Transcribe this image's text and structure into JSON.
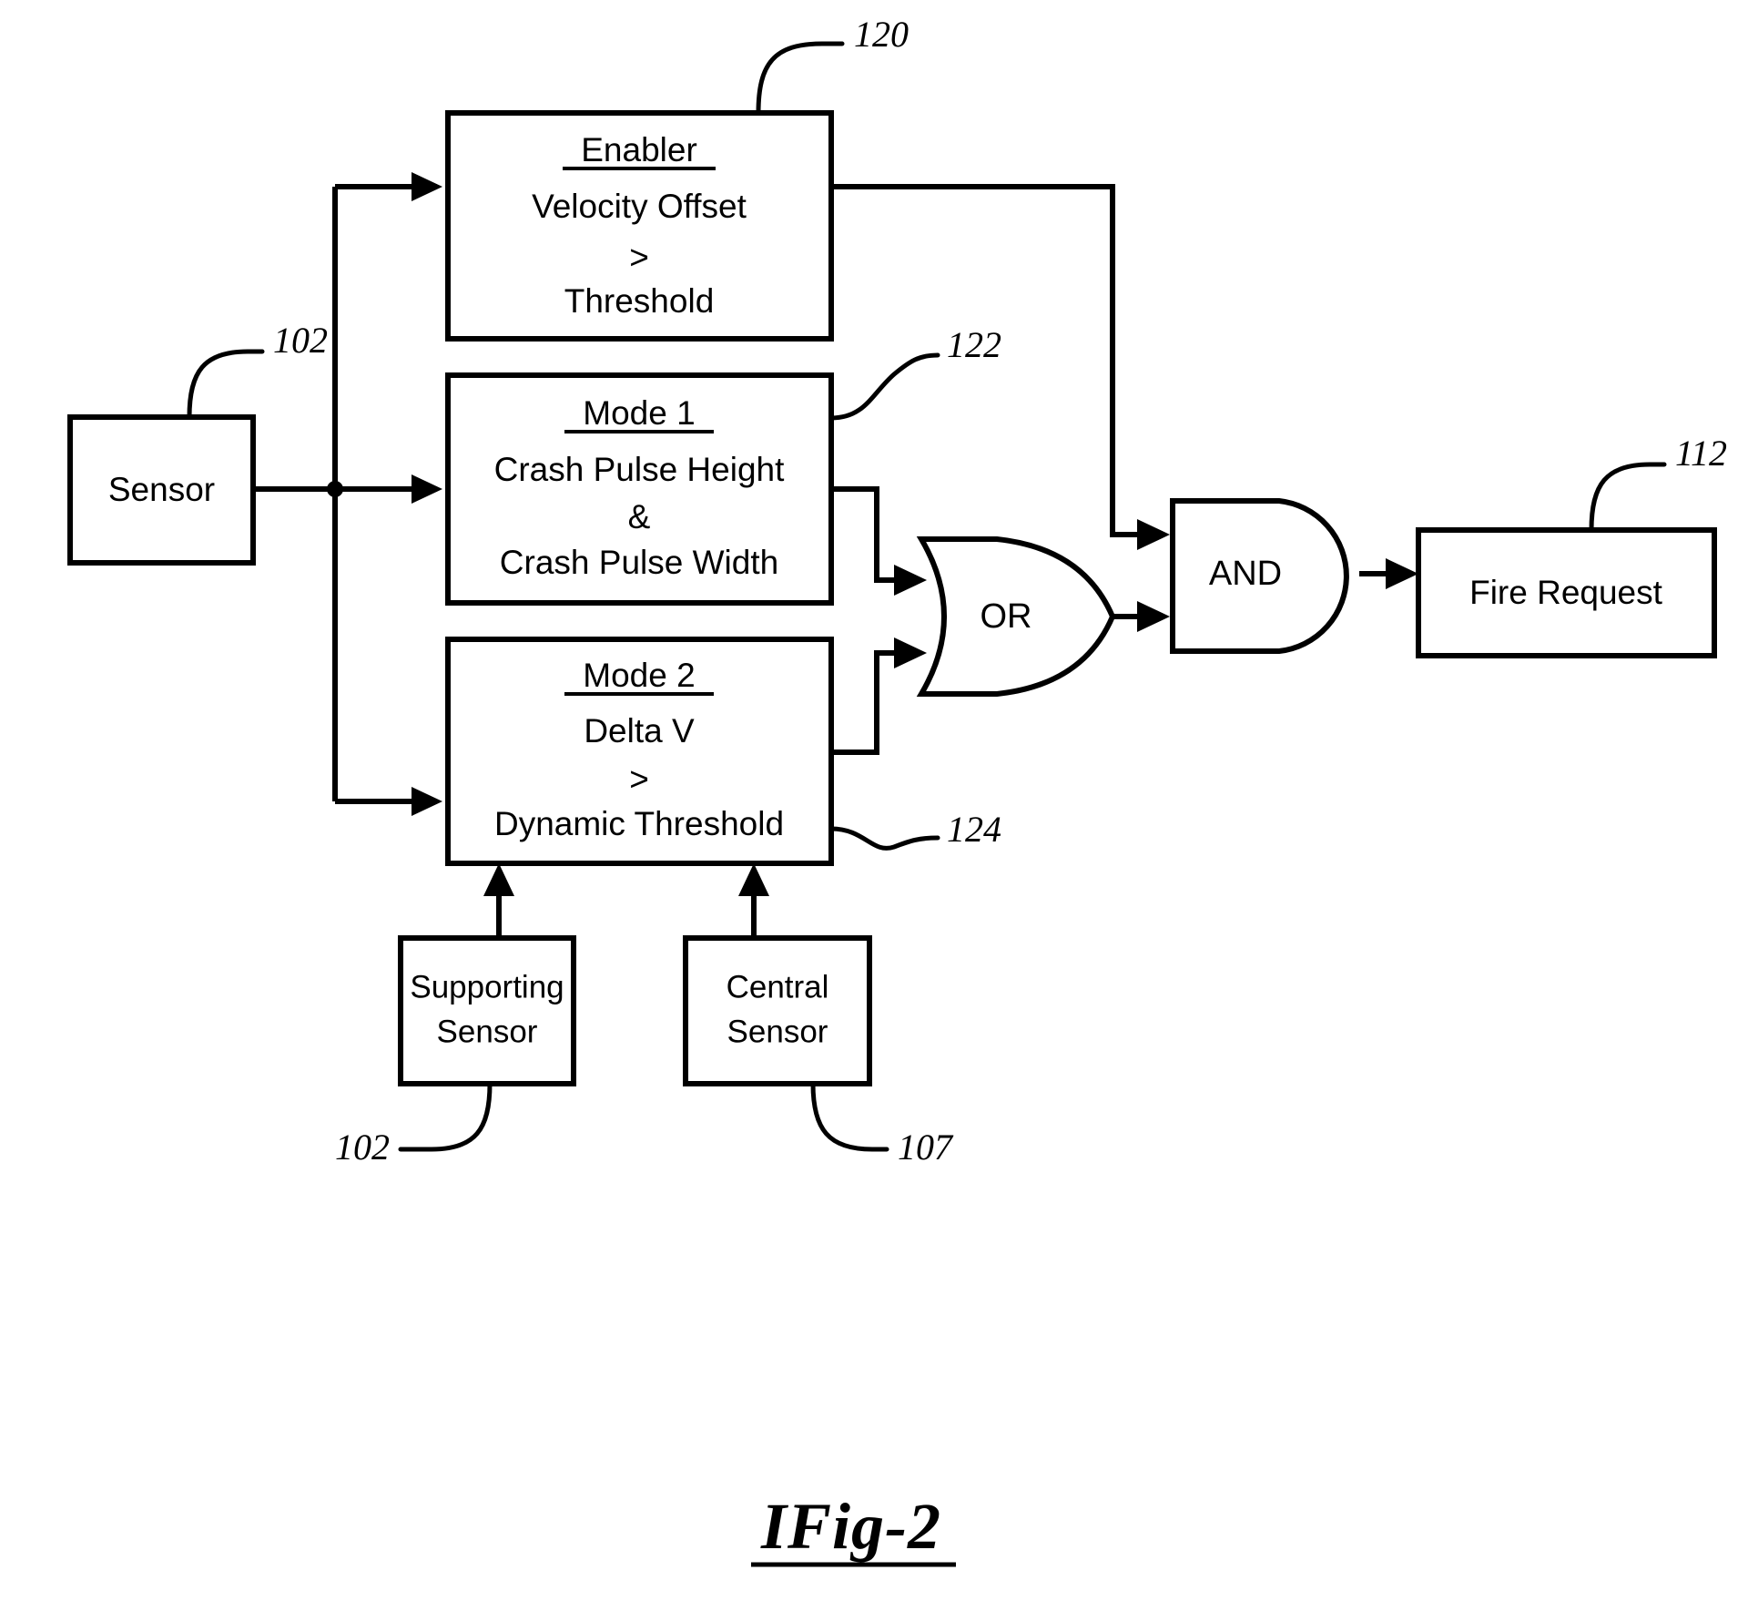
{
  "figure": {
    "caption": "Fig-2",
    "caption_prefix": "I"
  },
  "blocks": {
    "sensor": {
      "label": "Sensor",
      "ref": "102"
    },
    "enabler": {
      "title": "Enabler",
      "line1": "Velocity Offset",
      "line2": ">",
      "line3": "Threshold",
      "ref": "120"
    },
    "mode1": {
      "title": "Mode 1",
      "line1": "Crash Pulse Height",
      "line2": "&",
      "line3": "Crash Pulse Width",
      "ref": "122"
    },
    "mode2": {
      "title": "Mode 2",
      "line1": "Delta V",
      "line2": ">",
      "line3": "Dynamic Threshold",
      "ref": "124"
    },
    "supporting_sensor": {
      "line1": "Supporting",
      "line2": "Sensor",
      "ref": "102"
    },
    "central_sensor": {
      "line1": "Central",
      "line2": "Sensor",
      "ref": "107"
    },
    "fire_request": {
      "label": "Fire Request",
      "ref": "112"
    }
  },
  "gates": {
    "or_gate": {
      "label": "OR"
    },
    "and_gate": {
      "label": "AND"
    }
  },
  "colors": {
    "stroke": "#000000",
    "background": "#ffffff"
  }
}
